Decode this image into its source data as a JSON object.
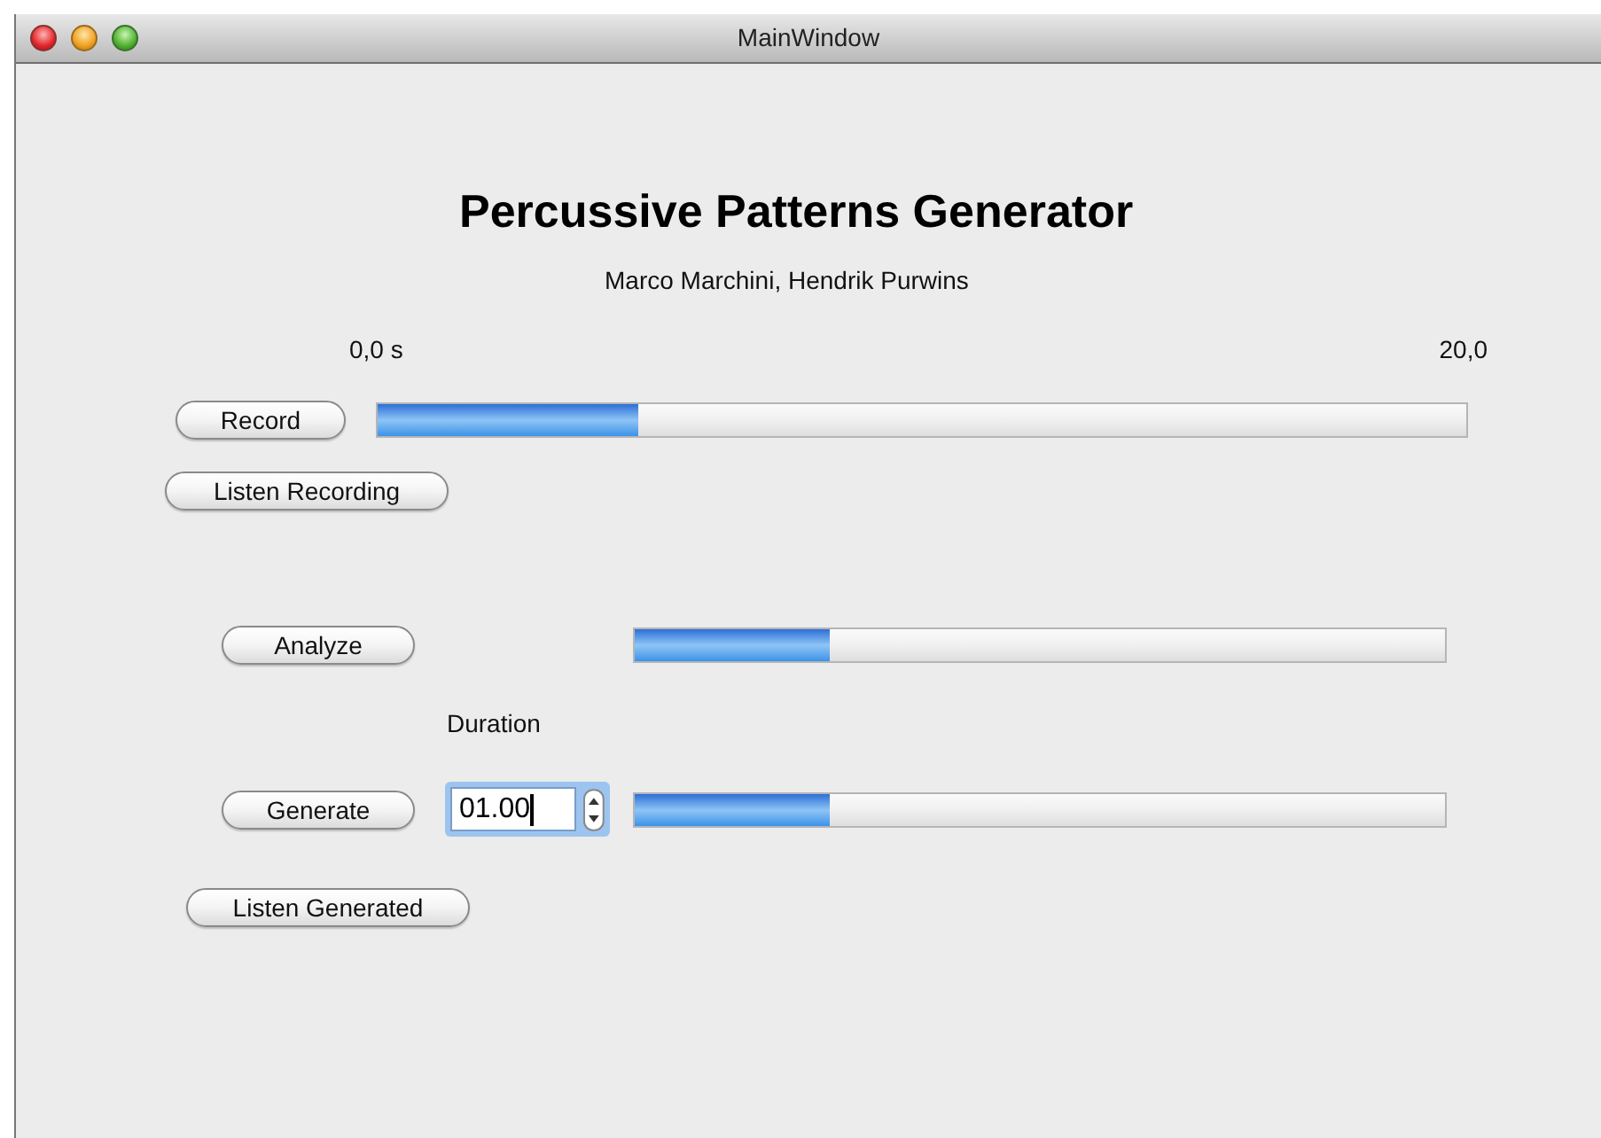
{
  "window": {
    "title": "MainWindow"
  },
  "heading": "Percussive Patterns Generator",
  "authors": "Marco Marchini, Hendrik Purwins",
  "time_axis": {
    "start": "0,0 s",
    "end": "20,0"
  },
  "record": {
    "button": "Record",
    "level": 0.24
  },
  "listen_recording": "Listen Recording",
  "analyze": {
    "button": "Analyze",
    "level": 0.24
  },
  "duration": {
    "label": "Duration",
    "value": "01.00",
    "focused": true
  },
  "generate": {
    "button": "Generate",
    "level": 0.24
  },
  "listen_generated": "Listen Generated"
}
